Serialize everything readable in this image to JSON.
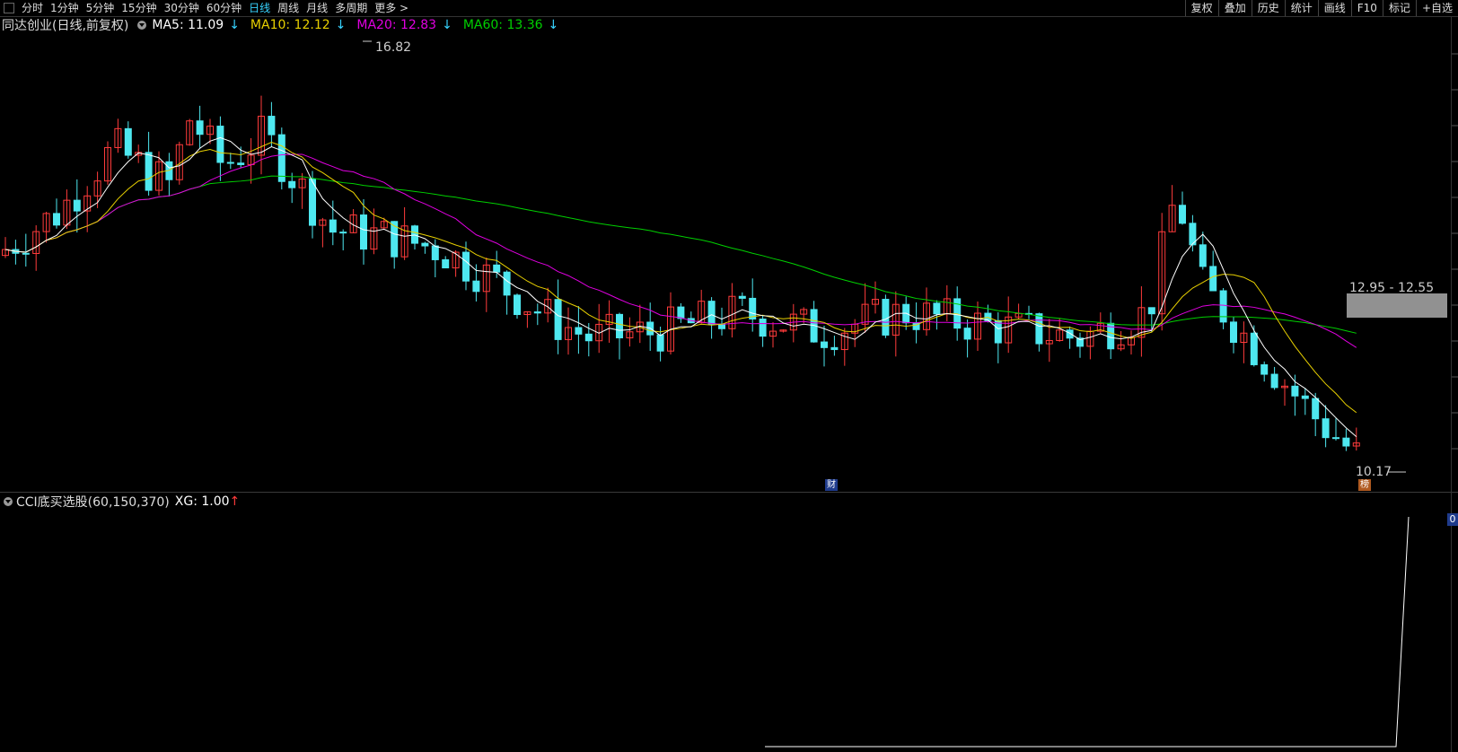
{
  "toolbar": {
    "periods": [
      "分时",
      "1分钟",
      "5分钟",
      "15分钟",
      "30分钟",
      "60分钟",
      "日线",
      "周线",
      "月线",
      "多周期",
      "更多 >"
    ],
    "active_period": "日线",
    "right_buttons": [
      "复权",
      "叠加",
      "历史",
      "统计",
      "画线",
      "F10",
      "标记",
      "+自选"
    ]
  },
  "main": {
    "title": "同达创业(日线,前复权)",
    "ma5": "MA5: 11.09",
    "ma10": "MA10: 12.12",
    "ma20": "MA20: 12.83",
    "ma60": "MA60: 13.36",
    "ma_arrow": "↓",
    "high_label": "16.82",
    "low_label": "10.17",
    "range_label": "12.95 - 12.55",
    "colors": {
      "ma5": "#ffffff",
      "ma10": "#e8d000",
      "ma20": "#e000e0",
      "ma60": "#00d000",
      "up": "#ff3b3b",
      "down": "#4ee8f0"
    }
  },
  "sub": {
    "title": "CCI底买选股(60,150,370)",
    "xg": "XG: 1.00",
    "xg_arrow": "↑",
    "zero": "0"
  },
  "badges": {
    "cai": "财",
    "bang": "榜"
  }
}
